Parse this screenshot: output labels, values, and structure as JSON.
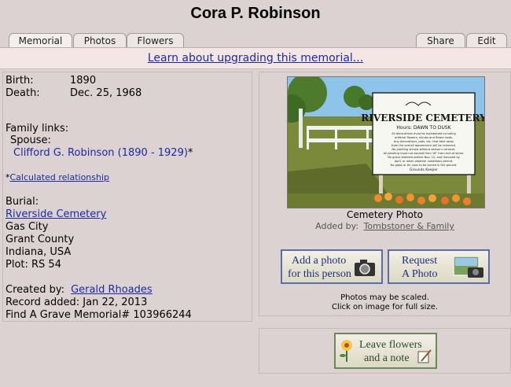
{
  "title": "Cora P. Robinson",
  "tabs": [
    "Memorial",
    "Photos",
    "Flowers"
  ],
  "tabs_right": [
    "Share",
    "Edit"
  ],
  "banner_link": "Learn about upgrading this memorial...",
  "person": {
    "birth_label": "Birth:",
    "birth_value": "1890",
    "death_label": "Death:",
    "death_value": "Dec. 25, 1968",
    "family_links_label": "Family links:",
    "spouse_label": "Spouse:",
    "spouse_link": "Clifford G. Robinson (1890 - 1929)",
    "spouse_mark": "*",
    "calc_mark": "*",
    "calc_link": "Calculated relationship",
    "burial_label": "Burial:",
    "cemetery_link": "Riverside Cemetery",
    "city": "Gas City",
    "county": "Grant County",
    "state_country": "Indiana, USA",
    "plot": "Plot: RS 54",
    "created_by_label": "Created by:",
    "created_by_link": "Gerald Rhoades",
    "record_added": "Record added: Jan 22, 2013",
    "memorial_no": "Find A Grave Memorial# 103966244"
  },
  "photo": {
    "sign_title": "RIVERSIDE CEMETERY",
    "sign_hours": "Hours: DAWN TO DUSK",
    "sign_text": [
      "All decorations must be maintained including",
      "artificial flowers, shrubs and flower beds.",
      "Any decorations, pots, etc. that take away",
      "from the overall appearance will be removed.",
      "No planting shrubs without sexton's consent.",
      "All planting must not exceed from 18\" from end of stone.",
      "No grave blankets before Nov. 15, and removed by",
      "April, or when weather conditions permit.",
      "No glass or tin cans to be buried in the ground."
    ],
    "sign_footer": "Grounds Keeper",
    "caption": "Cemetery Photo",
    "added_by_label": "Added by:",
    "added_by_link": "Tombstoner & Family"
  },
  "buttons": {
    "add_photo_l1": "Add a photo",
    "add_photo_l2": "for this person",
    "request_l1": "Request",
    "request_l2": "A Photo",
    "flowers_l1": "Leave flowers",
    "flowers_l2": "and a note"
  },
  "scale_note_1": "Photos may be scaled.",
  "scale_note_2": "Click on image for full size."
}
